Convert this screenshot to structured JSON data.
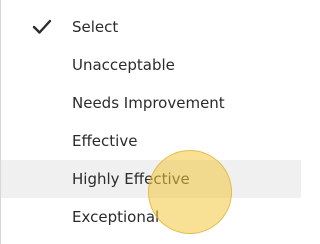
{
  "dropdown": {
    "selected_index": 0,
    "hover_index": 4,
    "options": [
      {
        "label": "Select"
      },
      {
        "label": "Unacceptable"
      },
      {
        "label": "Needs Improvement"
      },
      {
        "label": "Effective"
      },
      {
        "label": "Highly Effective"
      },
      {
        "label": "Exceptional"
      }
    ]
  },
  "icons": {
    "checkmark": "check-icon"
  },
  "colors": {
    "hover_background": "#f0f0f0",
    "cursor_highlight": "#f2c83e",
    "text": "#2b2b2b"
  }
}
